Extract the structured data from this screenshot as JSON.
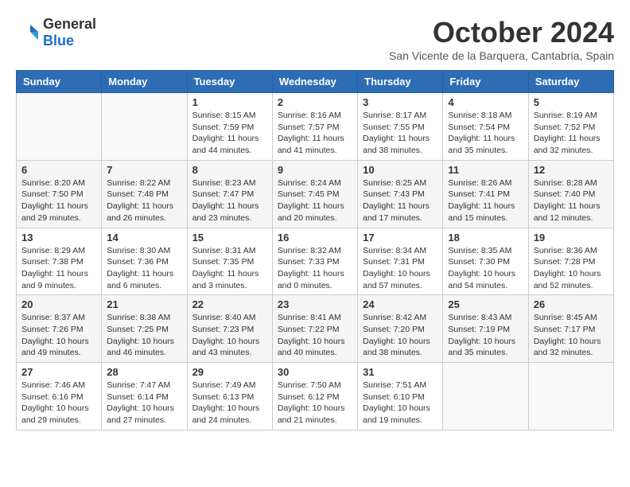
{
  "logo": {
    "general": "General",
    "blue": "Blue"
  },
  "title": "October 2024",
  "subtitle": "San Vicente de la Barquera, Cantabria, Spain",
  "weekdays": [
    "Sunday",
    "Monday",
    "Tuesday",
    "Wednesday",
    "Thursday",
    "Friday",
    "Saturday"
  ],
  "weeks": [
    [
      {
        "day": "",
        "sunrise": "",
        "sunset": "",
        "daylight": ""
      },
      {
        "day": "",
        "sunrise": "",
        "sunset": "",
        "daylight": ""
      },
      {
        "day": "1",
        "sunrise": "Sunrise: 8:15 AM",
        "sunset": "Sunset: 7:59 PM",
        "daylight": "Daylight: 11 hours and 44 minutes."
      },
      {
        "day": "2",
        "sunrise": "Sunrise: 8:16 AM",
        "sunset": "Sunset: 7:57 PM",
        "daylight": "Daylight: 11 hours and 41 minutes."
      },
      {
        "day": "3",
        "sunrise": "Sunrise: 8:17 AM",
        "sunset": "Sunset: 7:55 PM",
        "daylight": "Daylight: 11 hours and 38 minutes."
      },
      {
        "day": "4",
        "sunrise": "Sunrise: 8:18 AM",
        "sunset": "Sunset: 7:54 PM",
        "daylight": "Daylight: 11 hours and 35 minutes."
      },
      {
        "day": "5",
        "sunrise": "Sunrise: 8:19 AM",
        "sunset": "Sunset: 7:52 PM",
        "daylight": "Daylight: 11 hours and 32 minutes."
      }
    ],
    [
      {
        "day": "6",
        "sunrise": "Sunrise: 8:20 AM",
        "sunset": "Sunset: 7:50 PM",
        "daylight": "Daylight: 11 hours and 29 minutes."
      },
      {
        "day": "7",
        "sunrise": "Sunrise: 8:22 AM",
        "sunset": "Sunset: 7:48 PM",
        "daylight": "Daylight: 11 hours and 26 minutes."
      },
      {
        "day": "8",
        "sunrise": "Sunrise: 8:23 AM",
        "sunset": "Sunset: 7:47 PM",
        "daylight": "Daylight: 11 hours and 23 minutes."
      },
      {
        "day": "9",
        "sunrise": "Sunrise: 8:24 AM",
        "sunset": "Sunset: 7:45 PM",
        "daylight": "Daylight: 11 hours and 20 minutes."
      },
      {
        "day": "10",
        "sunrise": "Sunrise: 8:25 AM",
        "sunset": "Sunset: 7:43 PM",
        "daylight": "Daylight: 11 hours and 17 minutes."
      },
      {
        "day": "11",
        "sunrise": "Sunrise: 8:26 AM",
        "sunset": "Sunset: 7:41 PM",
        "daylight": "Daylight: 11 hours and 15 minutes."
      },
      {
        "day": "12",
        "sunrise": "Sunrise: 8:28 AM",
        "sunset": "Sunset: 7:40 PM",
        "daylight": "Daylight: 11 hours and 12 minutes."
      }
    ],
    [
      {
        "day": "13",
        "sunrise": "Sunrise: 8:29 AM",
        "sunset": "Sunset: 7:38 PM",
        "daylight": "Daylight: 11 hours and 9 minutes."
      },
      {
        "day": "14",
        "sunrise": "Sunrise: 8:30 AM",
        "sunset": "Sunset: 7:36 PM",
        "daylight": "Daylight: 11 hours and 6 minutes."
      },
      {
        "day": "15",
        "sunrise": "Sunrise: 8:31 AM",
        "sunset": "Sunset: 7:35 PM",
        "daylight": "Daylight: 11 hours and 3 minutes."
      },
      {
        "day": "16",
        "sunrise": "Sunrise: 8:32 AM",
        "sunset": "Sunset: 7:33 PM",
        "daylight": "Daylight: 11 hours and 0 minutes."
      },
      {
        "day": "17",
        "sunrise": "Sunrise: 8:34 AM",
        "sunset": "Sunset: 7:31 PM",
        "daylight": "Daylight: 10 hours and 57 minutes."
      },
      {
        "day": "18",
        "sunrise": "Sunrise: 8:35 AM",
        "sunset": "Sunset: 7:30 PM",
        "daylight": "Daylight: 10 hours and 54 minutes."
      },
      {
        "day": "19",
        "sunrise": "Sunrise: 8:36 AM",
        "sunset": "Sunset: 7:28 PM",
        "daylight": "Daylight: 10 hours and 52 minutes."
      }
    ],
    [
      {
        "day": "20",
        "sunrise": "Sunrise: 8:37 AM",
        "sunset": "Sunset: 7:26 PM",
        "daylight": "Daylight: 10 hours and 49 minutes."
      },
      {
        "day": "21",
        "sunrise": "Sunrise: 8:38 AM",
        "sunset": "Sunset: 7:25 PM",
        "daylight": "Daylight: 10 hours and 46 minutes."
      },
      {
        "day": "22",
        "sunrise": "Sunrise: 8:40 AM",
        "sunset": "Sunset: 7:23 PM",
        "daylight": "Daylight: 10 hours and 43 minutes."
      },
      {
        "day": "23",
        "sunrise": "Sunrise: 8:41 AM",
        "sunset": "Sunset: 7:22 PM",
        "daylight": "Daylight: 10 hours and 40 minutes."
      },
      {
        "day": "24",
        "sunrise": "Sunrise: 8:42 AM",
        "sunset": "Sunset: 7:20 PM",
        "daylight": "Daylight: 10 hours and 38 minutes."
      },
      {
        "day": "25",
        "sunrise": "Sunrise: 8:43 AM",
        "sunset": "Sunset: 7:19 PM",
        "daylight": "Daylight: 10 hours and 35 minutes."
      },
      {
        "day": "26",
        "sunrise": "Sunrise: 8:45 AM",
        "sunset": "Sunset: 7:17 PM",
        "daylight": "Daylight: 10 hours and 32 minutes."
      }
    ],
    [
      {
        "day": "27",
        "sunrise": "Sunrise: 7:46 AM",
        "sunset": "Sunset: 6:16 PM",
        "daylight": "Daylight: 10 hours and 29 minutes."
      },
      {
        "day": "28",
        "sunrise": "Sunrise: 7:47 AM",
        "sunset": "Sunset: 6:14 PM",
        "daylight": "Daylight: 10 hours and 27 minutes."
      },
      {
        "day": "29",
        "sunrise": "Sunrise: 7:49 AM",
        "sunset": "Sunset: 6:13 PM",
        "daylight": "Daylight: 10 hours and 24 minutes."
      },
      {
        "day": "30",
        "sunrise": "Sunrise: 7:50 AM",
        "sunset": "Sunset: 6:12 PM",
        "daylight": "Daylight: 10 hours and 21 minutes."
      },
      {
        "day": "31",
        "sunrise": "Sunrise: 7:51 AM",
        "sunset": "Sunset: 6:10 PM",
        "daylight": "Daylight: 10 hours and 19 minutes."
      },
      {
        "day": "",
        "sunrise": "",
        "sunset": "",
        "daylight": ""
      },
      {
        "day": "",
        "sunrise": "",
        "sunset": "",
        "daylight": ""
      }
    ]
  ]
}
